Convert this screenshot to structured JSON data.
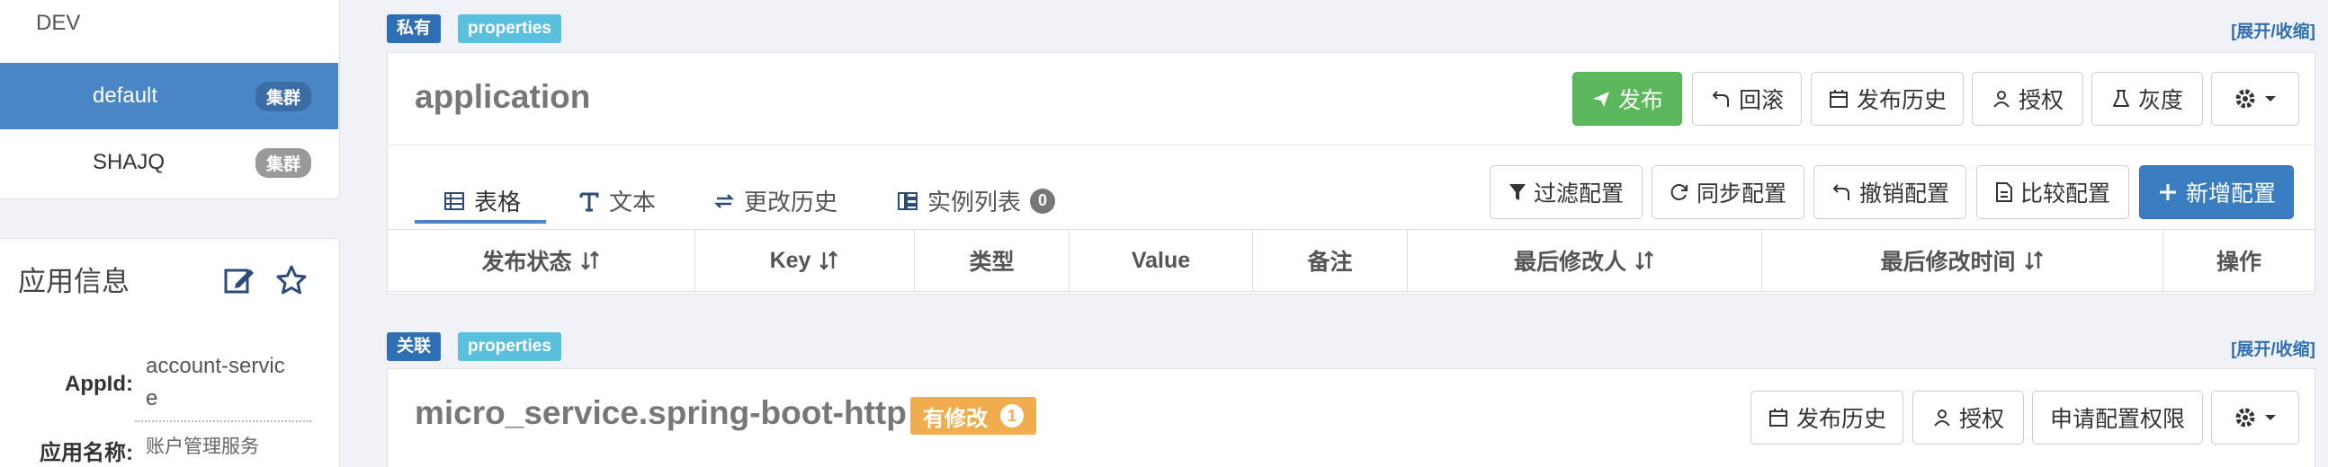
{
  "clusters": {
    "env": "DEV",
    "items": [
      {
        "name": "default",
        "badge": "集群",
        "active": true
      },
      {
        "name": "SHAJQ",
        "badge": "集群",
        "active": false
      }
    ]
  },
  "app_info": {
    "title": "应用信息",
    "appid_label": "AppId:",
    "appid_value_line1": "account-servic",
    "appid_value_line2": "e",
    "appname_label": "应用名称:",
    "appname_value": "账户管理服务"
  },
  "namespace1": {
    "tag_scope": "私有",
    "tag_format": "properties",
    "expand": "[展开/收缩]",
    "title": "application",
    "buttons": {
      "publish": "发布",
      "rollback": "回滚",
      "publish_history": "发布历史",
      "grant": "授权",
      "gray": "灰度"
    },
    "tabs": [
      {
        "label": "表格",
        "icon": "table-icon"
      },
      {
        "label": "文本",
        "icon": "text-icon"
      },
      {
        "label": "更改历史",
        "icon": "history-icon"
      },
      {
        "label": "实例列表",
        "icon": "instance-list-icon",
        "count": "0"
      }
    ],
    "actions": {
      "filter": "过滤配置",
      "sync": "同步配置",
      "revoke": "撤销配置",
      "compare": "比较配置",
      "add": "新增配置"
    },
    "columns": [
      "发布状态",
      "Key",
      "类型",
      "Value",
      "备注",
      "最后修改人",
      "最后修改时间",
      "操作"
    ]
  },
  "namespace2": {
    "tag_scope": "关联",
    "tag_format": "properties",
    "expand": "[展开/收缩]",
    "title": "micro_service.spring-boot-http",
    "modified_label": "有修改",
    "modified_count": "1",
    "buttons": {
      "publish_history": "发布历史",
      "grant": "授权",
      "apply_permission": "申请配置权限"
    }
  },
  "colors": {
    "accent": "#4a86c6",
    "publish_green": "#5cb85c",
    "add_blue": "#3a7dc1",
    "modified_orange": "#f0ad4e",
    "tag_light_blue": "#5bc0de"
  }
}
